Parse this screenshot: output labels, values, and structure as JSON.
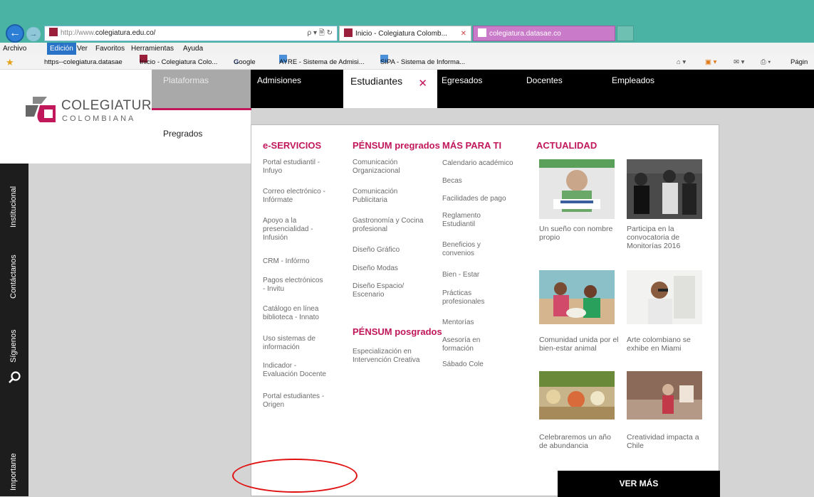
{
  "browser": {
    "back_symbol": "←",
    "forward_symbol": "→",
    "address": {
      "protocol": "http://www.",
      "domain": "colegiatura.edu.co/",
      "tools": "ρ ▾ 🗎 ↻"
    },
    "tabs": [
      {
        "title": "Inicio - Colegiatura Colomb...",
        "close": "✕"
      },
      {
        "title": "colegiatura.datasae.co"
      }
    ],
    "menu": [
      "Archivo",
      "Edición",
      "Ver",
      "Favoritos",
      "Herramientas",
      "Ayuda"
    ],
    "favorites": [
      "https--colegiatura.datasae",
      "Inicio - Colegiatura Colo...",
      "Google",
      "AYRE - Sistema de Admisi...",
      "SIPA - Sistema de Informa..."
    ],
    "page_label": "Págin"
  },
  "site": {
    "logo": {
      "line1": "COLEGIATURA",
      "line2": "COLOMBIANA"
    },
    "plataformas": "Plataformas",
    "pregrados": "Pregrados",
    "nav": [
      "Admisiones",
      "Estudiantes",
      "Egresados",
      "Docentes",
      "Empleados"
    ],
    "nav_close": "✕",
    "sidebar": [
      "Institucional",
      "Contáctanos",
      "Síguenos",
      "Importante"
    ],
    "eservicios": {
      "title": "e-SERVICIOS",
      "items": [
        "Portal estudiantil - Infuyo",
        "Correo electrónico - Infórmate",
        "Apoyo a la presencialidad - Infusión",
        "CRM - Infórmo",
        "Pagos electrónicos - Invitu",
        "Catálogo en línea biblioteca - Innato",
        "Uso sistemas de información",
        "Indicador - Evaluación Docente",
        "Portal estudiantes - Origen"
      ]
    },
    "pensum_pregrados": {
      "title": "PÉNSUM pregrados",
      "items": [
        "Comunicación Organizacional",
        "Comunicación Publicitaria",
        "Gastronomía y Cocina profesional",
        "Diseño Gráfico",
        "Diseño Modas",
        "Diseño Espacio/ Escenario"
      ]
    },
    "pensum_posgrados": {
      "title": "PÉNSUM posgrados",
      "items": [
        "Especialización en Intervención Creativa"
      ]
    },
    "mas_para_ti": {
      "title": "MÁS PARA TI",
      "items": [
        "Calendario académico",
        "Becas",
        "Facilidades de pago",
        "Reglamento Estudiantil",
        "Beneficios y convenios",
        "Bien - Estar",
        "Prácticas profesionales",
        "Mentorías",
        "Asesoría en formación",
        "Sábado Cole"
      ]
    },
    "actualidad": {
      "title": "ACTUALIDAD",
      "news": [
        "Un sueño con nombre propio",
        "Participa en la convocatoria de Monitorías 2016",
        "Comunidad unida por el bien-estar animal",
        "Arte colombiano se exhibe en Miami",
        "Celebraremos un año de abundancia",
        "Creatividad impacta a Chile"
      ],
      "ver_mas": "VER MÁS"
    }
  }
}
